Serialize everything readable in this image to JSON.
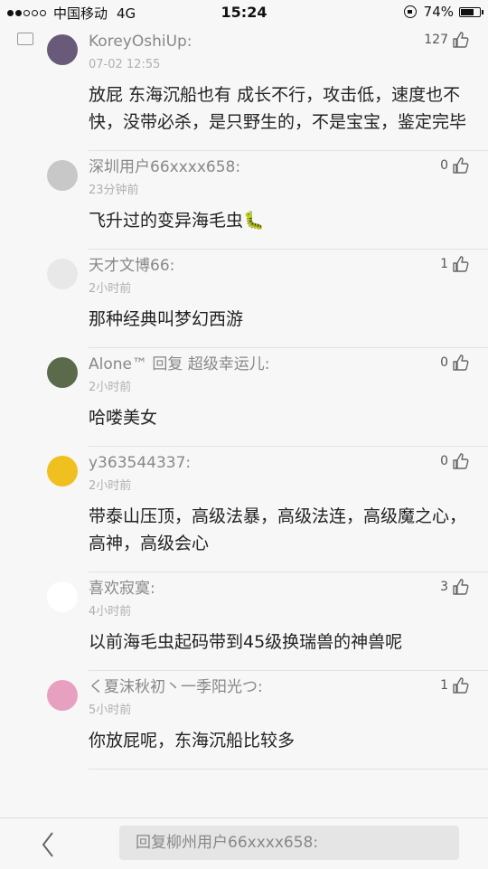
{
  "status_bar": {
    "carrier": "中国移动",
    "network": "4G",
    "time": "15:24",
    "battery": "74%",
    "battery_level": 0.74
  },
  "comments": [
    {
      "username": "KoreyOshiUp:",
      "timestamp": "07-02 12:55",
      "likes": "127",
      "content": "放屁 东海沉船也有 成长不行，攻击低，速度也不快，没带必杀，是只野生的，不是宝宝，鉴定完毕",
      "avatar_color": "#6a5a7a"
    },
    {
      "username": "深圳用户66xxxx658:",
      "timestamp": "23分钟前",
      "likes": "0",
      "content": "飞升过的变异海毛虫🐛",
      "avatar_color": "#c8c8c8"
    },
    {
      "username": "天才文博66:",
      "timestamp": "2小时前",
      "likes": "1",
      "content": "那种经典叫梦幻西游",
      "avatar_color": "#e8e8e8"
    },
    {
      "username": "Alone™ 回复 超级幸运儿:",
      "timestamp": "2小时前",
      "likes": "0",
      "content": "哈喽美女",
      "avatar_color": "#5a6a4a"
    },
    {
      "username": "y363544337:",
      "timestamp": "2小时前",
      "likes": "0",
      "content": "带泰山压顶，高级法暴，高级法连，高级魔之心，高神，高级会心",
      "avatar_color": "#f0c020"
    },
    {
      "username": "喜欢寂寞:",
      "timestamp": "4小时前",
      "likes": "3",
      "content": "以前海毛虫起码带到45级换瑞兽的神兽呢",
      "avatar_color": "#ffffff"
    },
    {
      "username": "く夏沫秋初丶一季阳光つ:",
      "timestamp": "5小时前",
      "likes": "1",
      "content": "你放屁呢，东海沉船比较多",
      "avatar_color": "#e8a0c0"
    }
  ],
  "reply": {
    "placeholder": "回复柳州用户66xxxx658:"
  }
}
